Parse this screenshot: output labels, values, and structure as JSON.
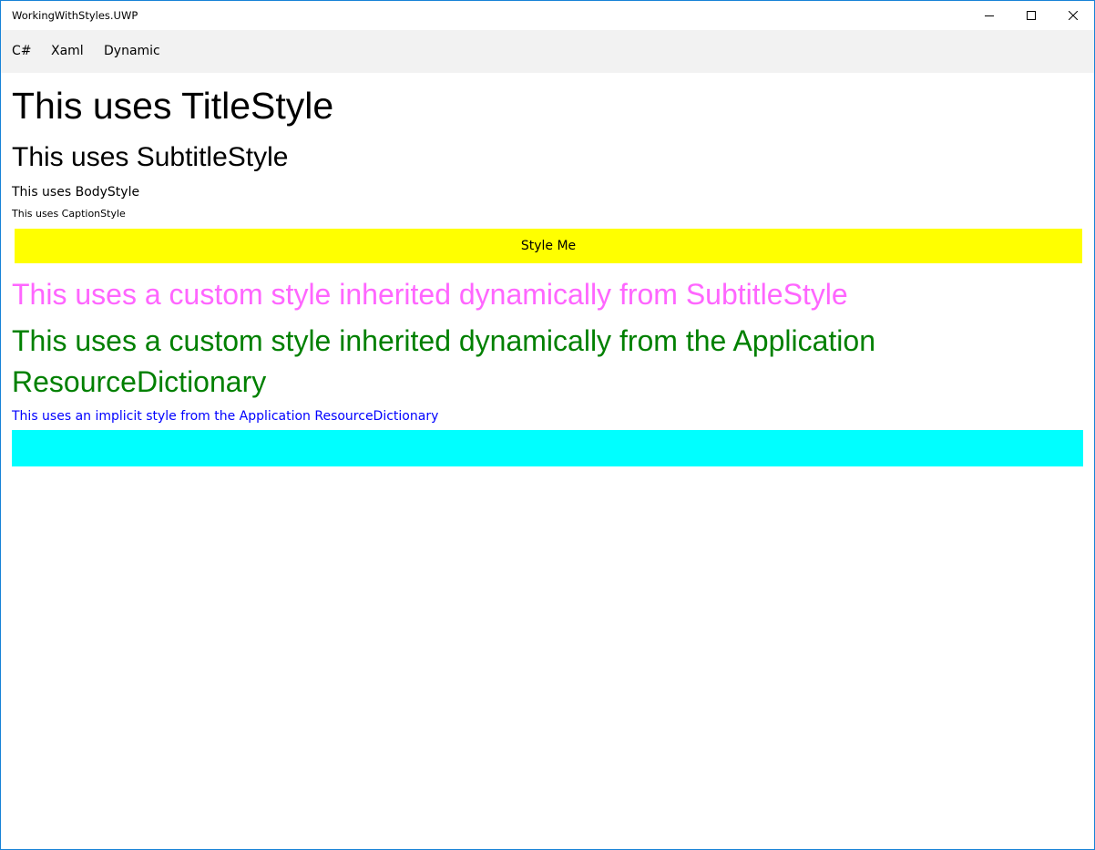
{
  "window": {
    "title": "WorkingWithStyles.UWP",
    "border_color": "#1883d7"
  },
  "caption_buttons": {
    "minimize_icon": "minimize-icon",
    "maximize_icon": "maximize-icon",
    "close_icon": "close-icon"
  },
  "tabs": [
    {
      "label": "C#"
    },
    {
      "label": "Xaml"
    },
    {
      "label": "Dynamic"
    }
  ],
  "content": {
    "title_text": "This uses TitleStyle",
    "subtitle_text": "This uses SubtitleStyle",
    "body_text": "This uses BodyStyle",
    "caption_text": "This uses CaptionStyle",
    "style_button_label": "Style Me",
    "custom_pink_text": "This uses a custom style inherited dynamically from SubtitleStyle",
    "custom_green_text": "This uses a custom style inherited dynamically from the Application ResourceDictionary",
    "implicit_text": "This uses an implicit style from the Application ResourceDictionary",
    "entry_value": ""
  },
  "colors": {
    "tab_bar_background": "#f2f2f2",
    "button_background": "#ffff00",
    "custom_pink": "#ff66ff",
    "custom_green": "#008000",
    "implicit_blue": "#0000ff",
    "entry_background": "#00ffff"
  }
}
